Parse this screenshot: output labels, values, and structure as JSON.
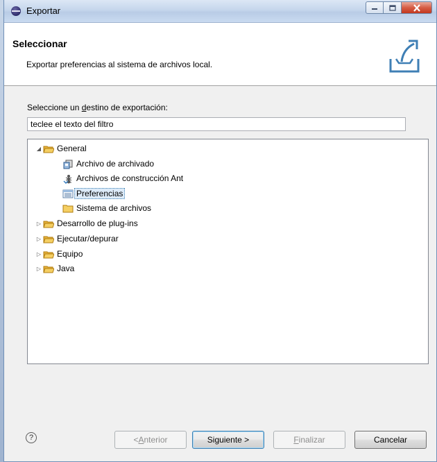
{
  "window": {
    "title": "Exportar",
    "icon": "eclipse-icon"
  },
  "header": {
    "title": "Seleccionar",
    "description": "Exportar preferencias al sistema de archivos local."
  },
  "prompt": {
    "before": "Seleccione un ",
    "underlined": "d",
    "after": "estino de exportación:"
  },
  "filter": {
    "value": "teclee el texto del filtro"
  },
  "tree": [
    {
      "label": "General",
      "expanded": true,
      "level": 0,
      "icon": "folder-open-icon"
    },
    {
      "label": "Archivo de archivado",
      "level": 1,
      "icon": "archive-icon"
    },
    {
      "label": "Archivos de construcción Ant",
      "level": 1,
      "icon": "ant-icon"
    },
    {
      "label": "Preferencias",
      "level": 1,
      "icon": "preferences-icon",
      "selected": true
    },
    {
      "label": "Sistema de archivos",
      "level": 1,
      "icon": "folder-icon"
    },
    {
      "label": "Desarrollo de plug-ins",
      "level": 0,
      "icon": "folder-open-icon"
    },
    {
      "label": "Ejecutar/depurar",
      "level": 0,
      "icon": "folder-open-icon"
    },
    {
      "label": "Equipo",
      "level": 0,
      "icon": "folder-open-icon"
    },
    {
      "label": "Java",
      "level": 0,
      "icon": "folder-open-icon"
    }
  ],
  "buttons": {
    "back": {
      "pre": "< ",
      "u": "A",
      "post": "nterior",
      "enabled": false
    },
    "next": {
      "label": "Siguiente >",
      "enabled": true
    },
    "finish": {
      "pre": "",
      "u": "F",
      "post": "inalizar",
      "enabled": false
    },
    "cancel": {
      "label": "Cancelar",
      "enabled": true
    }
  },
  "help": "?"
}
